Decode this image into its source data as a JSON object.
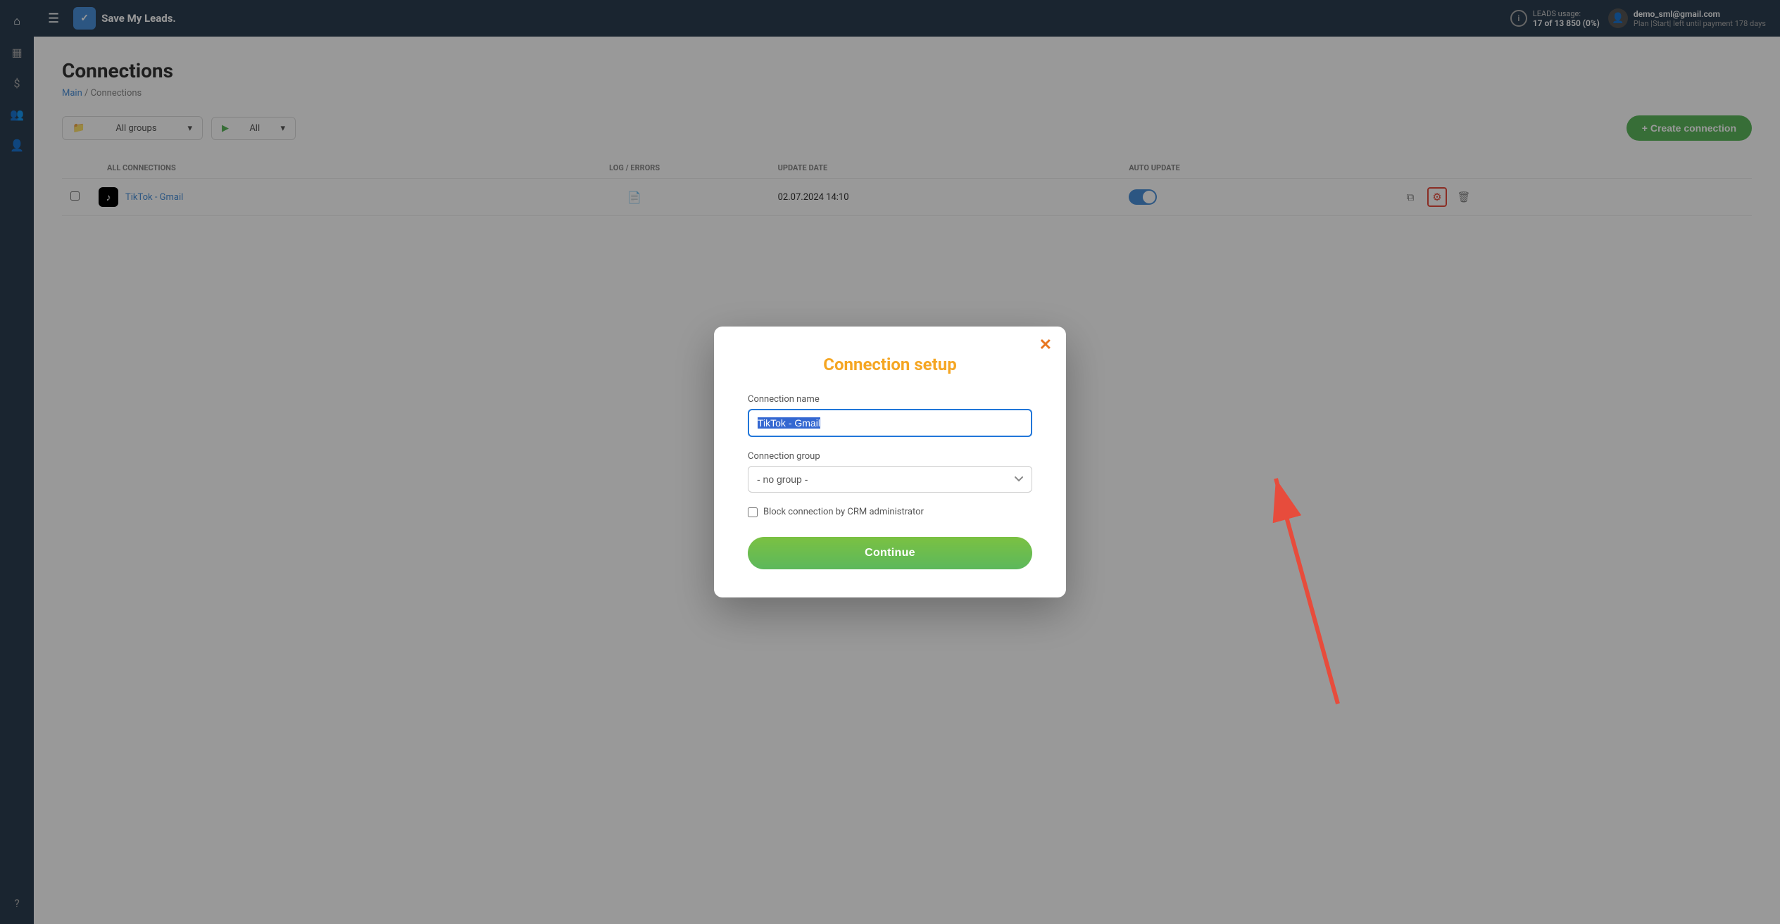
{
  "app": {
    "name": "Save My Leads.",
    "hamburger_label": "☰",
    "logo_icon": "✓"
  },
  "header": {
    "leads_label": "LEADS usage:",
    "leads_value": "17 of 13 850 (0%)",
    "user_email": "demo_sml@gmail.com",
    "user_plan": "Plan |Start| left until payment 178 days"
  },
  "sidebar": {
    "icons": [
      {
        "name": "home-icon",
        "symbol": "⌂"
      },
      {
        "name": "dashboard-icon",
        "symbol": "▦"
      },
      {
        "name": "billing-icon",
        "symbol": "$"
      },
      {
        "name": "team-icon",
        "symbol": "👥"
      },
      {
        "name": "user-icon",
        "symbol": "👤"
      },
      {
        "name": "help-icon",
        "symbol": "?"
      }
    ]
  },
  "page": {
    "title": "Connections",
    "breadcrumb_main": "Main",
    "breadcrumb_separator": " / ",
    "breadcrumb_current": "Connections"
  },
  "toolbar": {
    "group_select_label": "All groups",
    "all_select_label": "All ",
    "create_button_label": "+ Create connection"
  },
  "table": {
    "section_label": "ALL CONNECTIONS",
    "columns": [
      {
        "name": "col-name",
        "label": ""
      },
      {
        "name": "col-log",
        "label": "LOG / ERRORS"
      },
      {
        "name": "col-update",
        "label": "UPDATE DATE"
      },
      {
        "name": "col-auto",
        "label": "AUTO UPDATE"
      },
      {
        "name": "col-actions",
        "label": ""
      }
    ],
    "rows": [
      {
        "icon": "♪",
        "name": "TikTok - Gmail",
        "log_icon": "📄",
        "update_date": "02.07.2024 14:10",
        "auto_update": true,
        "actions": [
          "copy",
          "gear",
          "delete"
        ]
      }
    ]
  },
  "modal": {
    "title": "Connection setup",
    "close_symbol": "✕",
    "connection_name_label": "Connection name",
    "connection_name_value": "TikTok - Gmail",
    "connection_group_label": "Connection group",
    "connection_group_value": "- no group -",
    "group_options": [
      "- no group -"
    ],
    "block_connection_label": "Block connection by CRM administrator",
    "continue_button_label": "Continue"
  }
}
